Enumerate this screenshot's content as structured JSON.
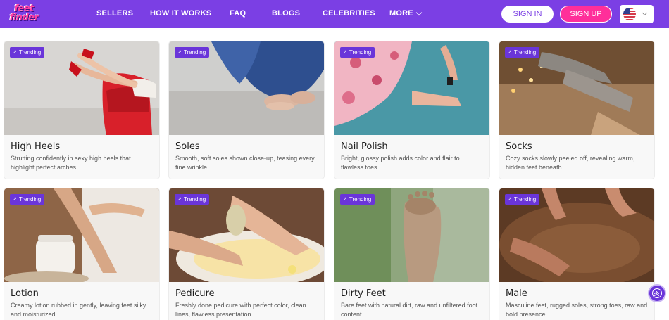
{
  "header": {
    "logo_line1": "feet",
    "logo_line2": "finder",
    "nav": [
      "SELLERS",
      "HOW IT WORKS",
      "FAQ",
      "BLOGS",
      "CELEBRITIES",
      "MORE"
    ],
    "sign_in": "SIGN IN",
    "sign_up": "SIGN UP",
    "language_flag": "us-flag-icon"
  },
  "colors": {
    "brand_purple": "#7b3fe4",
    "brand_pink": "#ff2f9a",
    "badge_purple": "#6a35d9"
  },
  "cards": [
    {
      "badge": "Trending",
      "title": "High Heels",
      "description": "Strutting confidently in sexy high heels that highlight perfect arches."
    },
    {
      "badge": "Trending",
      "title": "Soles",
      "description": "Smooth, soft soles shown close-up, teasing every fine wrinkle."
    },
    {
      "badge": "Trending",
      "title": "Nail Polish",
      "description": "Bright, glossy polish adds color and flair to flawless toes."
    },
    {
      "badge": "Trending",
      "title": "Socks",
      "description": "Cozy socks slowly peeled off, revealing warm, hidden feet beneath."
    },
    {
      "badge": "Trending",
      "title": "Lotion",
      "description": "Creamy lotion rubbed in gently, leaving feet silky and moisturized."
    },
    {
      "badge": "Trending",
      "title": "Pedicure",
      "description": "Freshly done pedicure with perfect color, clean lines, flawless presentation."
    },
    {
      "badge": "Trending",
      "title": "Dirty Feet",
      "description": "Bare feet with natural dirt, raw and unfiltered foot content."
    },
    {
      "badge": "Trending",
      "title": "Male",
      "description": "Masculine feet, rugged soles, strong toes, raw and bold presence."
    }
  ]
}
